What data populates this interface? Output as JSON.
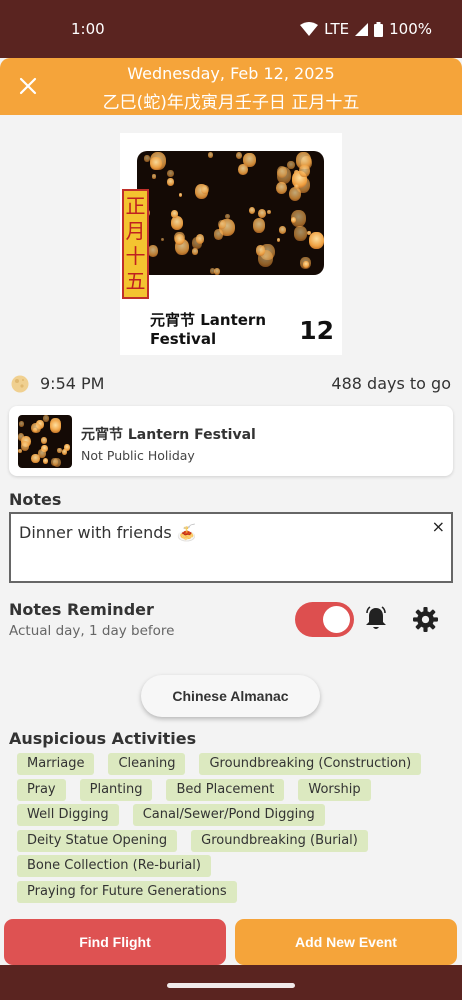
{
  "status_bar": {
    "time": "1:00",
    "network": "LTE",
    "battery": "100%"
  },
  "header": {
    "date": "Wednesday, Feb 12, 2025",
    "lunar_date": "乙巳(蛇)年戊寅月壬子日 正月十五"
  },
  "card": {
    "lunar_tag": "正月十五",
    "title": "元宵节 Lantern Festival",
    "day": "12"
  },
  "moon": {
    "time": "9:54 PM",
    "days_to_go": "488 days to go"
  },
  "event": {
    "name": "元宵节 Lantern Festival",
    "status": "Not Public Holiday"
  },
  "notes": {
    "label": "Notes",
    "value": "Dinner with friends 🍝",
    "clear": "×"
  },
  "reminder": {
    "label": "Notes Reminder",
    "subtitle": "Actual day, 1 day before",
    "enabled": true
  },
  "almanac": {
    "label": "Chinese Almanac"
  },
  "auspicious": {
    "title": "Auspicious Activities",
    "rows": [
      [
        "Marriage",
        "Cleaning",
        "Groundbreaking (Construction)"
      ],
      [
        "Pray",
        "Planting",
        "Bed Placement",
        "Worship"
      ],
      [
        "Well Digging",
        "Canal/Sewer/Pond Digging"
      ],
      [
        "Deity Statue Opening",
        "Groundbreaking (Burial)"
      ],
      [
        "Bone Collection (Re-burial)"
      ],
      [
        "Praying for Future Generations"
      ]
    ]
  },
  "actions": {
    "find_flight": "Find Flight",
    "add_event": "Add New Event"
  },
  "colors": {
    "status_bar": "#5a2420",
    "header": "#f5a43a",
    "find_flight": "#de5252",
    "add_event": "#f5a43a",
    "chip": "#dce9c0",
    "toggle": "#dd4f4f"
  },
  "icons": {
    "close": "close-icon",
    "moon": "moon-icon",
    "bell": "bell-icon",
    "gear": "gear-icon",
    "wifi": "wifi-icon",
    "signal": "signal-icon",
    "battery": "battery-icon"
  }
}
